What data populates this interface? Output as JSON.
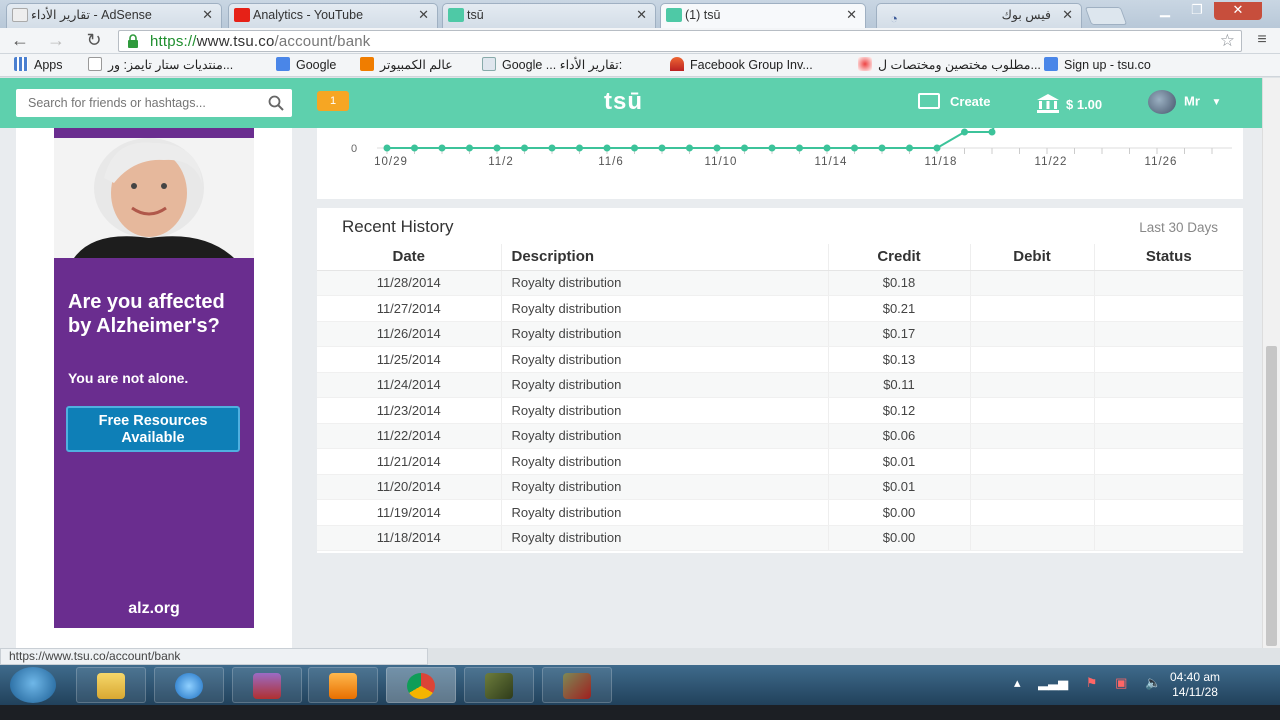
{
  "browser": {
    "tabs": [
      {
        "label": "تقارير الأداء - AdSense"
      },
      {
        "label": "Analytics - YouTube"
      },
      {
        "label": "tsū"
      },
      {
        "label": "(1) tsū"
      },
      {
        "label": "فيس بوك"
      }
    ],
    "url": {
      "scheme": "https://",
      "host": "www.tsu.co",
      "path": "/account/bank"
    },
    "bookmarks": [
      "Apps",
      "منتديات ستار تايمز: ور...",
      "Google",
      "عالم الكمبيوتر",
      "Google ... تقارير الأداء:",
      "Facebook Group Inv...",
      "مطلوب مختصين ومختصات ل...",
      "Sign up - tsu.co"
    ],
    "status_url": "https://www.tsu.co/account/bank"
  },
  "header": {
    "search_placeholder": "Search for friends or hashtags...",
    "notification_count": "1",
    "logo": "tsū",
    "create_label": "Create",
    "balance": "$ 1.00",
    "user_name": "Mr"
  },
  "ad": {
    "headline": "Are you affected by Alzheimer's?",
    "subline": "You are not alone.",
    "button_label": "Free Resources Available",
    "domain": "alz.org"
  },
  "chart_data": {
    "type": "line",
    "title": "",
    "x": [
      "10/29",
      "10/30",
      "10/31",
      "11/1",
      "11/2",
      "11/3",
      "11/4",
      "11/5",
      "11/6",
      "11/7",
      "11/8",
      "11/9",
      "11/10",
      "11/11",
      "11/12",
      "11/13",
      "11/14",
      "11/15",
      "11/16",
      "11/17",
      "11/18",
      "11/19",
      "11/20",
      "11/21"
    ],
    "y": [
      0,
      0,
      0,
      0,
      0,
      0,
      0,
      0,
      0,
      0,
      0,
      0,
      0,
      0,
      0,
      0,
      0,
      0,
      0,
      0,
      0,
      0.01,
      0.01,
      0.06
    ],
    "xticks": [
      "10/29",
      "11/2",
      "11/6",
      "11/10",
      "11/14",
      "11/18",
      "11/22",
      "11/26"
    ],
    "yticks": [
      "0"
    ],
    "color": "#3cc39a"
  },
  "history": {
    "title": "Recent History",
    "range_label": "Last 30 Days",
    "columns": [
      "Date",
      "Description",
      "Credit",
      "Debit",
      "Status"
    ],
    "rows": [
      {
        "date": "11/28/2014",
        "description": "Royalty distribution",
        "credit": "$0.18",
        "debit": "",
        "status": ""
      },
      {
        "date": "11/27/2014",
        "description": "Royalty distribution",
        "credit": "$0.21",
        "debit": "",
        "status": ""
      },
      {
        "date": "11/26/2014",
        "description": "Royalty distribution",
        "credit": "$0.17",
        "debit": "",
        "status": ""
      },
      {
        "date": "11/25/2014",
        "description": "Royalty distribution",
        "credit": "$0.13",
        "debit": "",
        "status": ""
      },
      {
        "date": "11/24/2014",
        "description": "Royalty distribution",
        "credit": "$0.11",
        "debit": "",
        "status": ""
      },
      {
        "date": "11/23/2014",
        "description": "Royalty distribution",
        "credit": "$0.12",
        "debit": "",
        "status": ""
      },
      {
        "date": "11/22/2014",
        "description": "Royalty distribution",
        "credit": "$0.06",
        "debit": "",
        "status": ""
      },
      {
        "date": "11/21/2014",
        "description": "Royalty distribution",
        "credit": "$0.01",
        "debit": "",
        "status": ""
      },
      {
        "date": "11/20/2014",
        "description": "Royalty distribution",
        "credit": "$0.01",
        "debit": "",
        "status": ""
      },
      {
        "date": "11/19/2014",
        "description": "Royalty distribution",
        "credit": "$0.00",
        "debit": "",
        "status": ""
      },
      {
        "date": "11/18/2014",
        "description": "Royalty distribution",
        "credit": "$0.00",
        "debit": "",
        "status": ""
      }
    ]
  },
  "taskbar": {
    "clock_time": "04:40 am",
    "clock_date": "14/11/28"
  }
}
